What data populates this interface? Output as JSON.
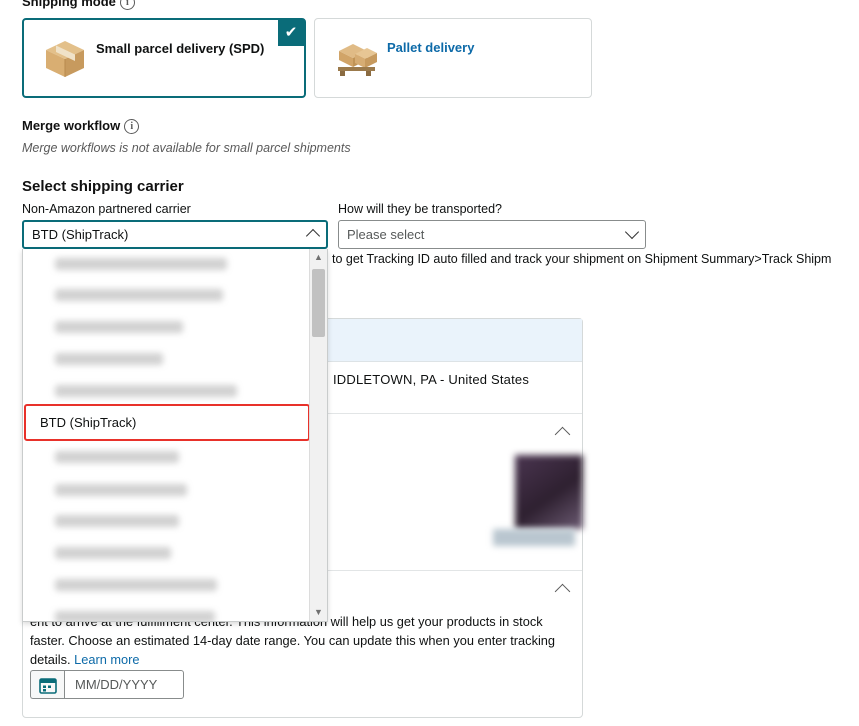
{
  "shipping_mode": {
    "label": "Shipping mode",
    "info_icon": "info-icon",
    "options": [
      {
        "id": "spd",
        "label": "Small parcel delivery (SPD)",
        "selected": true,
        "icon": "parcel-box-icon",
        "check": "✔"
      },
      {
        "id": "pallet",
        "label": "Pallet delivery",
        "selected": false,
        "icon": "pallet-icon"
      }
    ]
  },
  "merge_workflow": {
    "label": "Merge workflow",
    "info_icon": "info-icon",
    "note": "Merge workflows is not available for small parcel shipments"
  },
  "carrier_section": {
    "heading": "Select shipping carrier",
    "carrier_label": "Non-Amazon partnered carrier",
    "carrier_value": "BTD (ShipTrack)",
    "carrier_caret": "chevron-up-icon",
    "transport_label": "How will they be transported?",
    "transport_value": "Please select",
    "transport_caret": "chevron-down-icon",
    "hint": "to get Tracking ID auto filled and track your shipment on Shipment Summary>Track Shipm"
  },
  "dropdown": {
    "scroll_up": "▲",
    "scroll_down": "▼",
    "highlighted_option": "BTD (ShipTrack)",
    "redacted_option_count": 12
  },
  "ship_panel": {
    "address": "IDDLETOWN,  PA -  United States",
    "collapse_caret_1": "chevron-up-icon",
    "collapse_caret_2": "chevron-up-icon"
  },
  "delivery": {
    "text_line1": "ent to arrive at the fulfillment center. This",
    "text_line2": "information will help us get your products in stock faster. Choose an estimated 14-day date",
    "text_line3": "range. You can update this when you enter tracking details.",
    "learn_more": "Learn more",
    "date_placeholder": "MM/DD/YYYY",
    "calendar_icon": "calendar-icon"
  },
  "colors": {
    "accent_teal": "#0a6c79",
    "link_blue": "#0d6aa8",
    "highlight_red": "#e8312a",
    "panel_blue": "#eaf3fb"
  }
}
